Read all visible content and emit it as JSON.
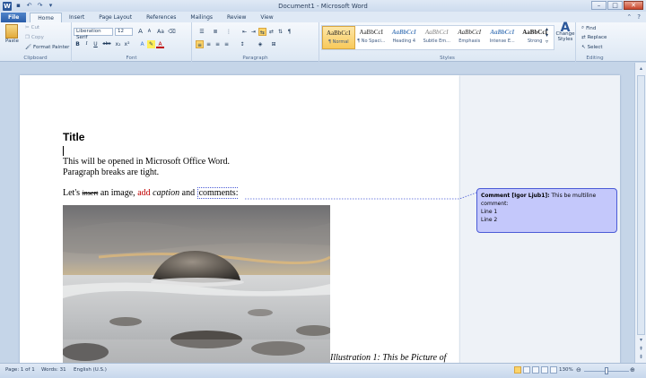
{
  "window": {
    "title": "Document1 - Microsoft Word",
    "app_icon": "W",
    "controls": {
      "minimize": "–",
      "maximize": "□",
      "close": "✕"
    }
  },
  "tabs": [
    "File",
    "Home",
    "Insert",
    "Page Layout",
    "References",
    "Mailings",
    "Review",
    "View"
  ],
  "ribbon": {
    "clipboard": {
      "paste": "Paste",
      "cut": "Cut",
      "copy": "Copy",
      "format_painter": "Format Painter",
      "label": "Clipboard"
    },
    "font": {
      "name": "Liberation Serif",
      "size": "12",
      "bold": "B",
      "italic": "I",
      "underline": "U",
      "strike": "abc",
      "subscript": "x₂",
      "superscript": "x²",
      "grow": "A",
      "shrink": "A",
      "case": "Aa",
      "label": "Font"
    },
    "paragraph": {
      "label": "Paragraph",
      "pilcrow": "¶"
    },
    "styles": {
      "items": [
        {
          "sample": "AaBbCcI",
          "name": "¶ Normal"
        },
        {
          "sample": "AaBbCcI",
          "name": "¶ No Spaci..."
        },
        {
          "sample": "AaBbCcI",
          "name": "Heading 4"
        },
        {
          "sample": "AaBbCcI",
          "name": "Subtle Em..."
        },
        {
          "sample": "AaBbCcI",
          "name": "Emphasis"
        },
        {
          "sample": "AaBbCcI",
          "name": "Intense E..."
        },
        {
          "sample": "AaBbCcI",
          "name": "Strong"
        }
      ],
      "change_styles": "Change Styles",
      "label": "Styles"
    },
    "editing": {
      "find": "Find",
      "replace": "Replace",
      "select": "Select",
      "label": "Editing"
    }
  },
  "document": {
    "title": "Title",
    "line1": "This will be opened in Microsoft Office Word.",
    "line2": "Paragraph breaks are tight.",
    "line3": {
      "p1": "Let's ",
      "deleted": "insert",
      "p2": " an image, ",
      "inserted": "add",
      "p3": " ",
      "italic": "caption",
      "p4": " and ",
      "commented": "comments:"
    },
    "caption": "Illustration 1: This be Picture of"
  },
  "comment": {
    "label": "Comment [Igor Ljub1]:",
    "text": "This be multiline comment:",
    "line1": "Line 1",
    "line2": "Line 2"
  },
  "status": {
    "page": "Page: 1 of 1",
    "words": "Words: 31",
    "language": "English (U.S.)",
    "zoom": "130%"
  },
  "colors": {
    "insertion": "#c00000",
    "comment_fill": "#c4c8fb",
    "comment_border": "#4a5bd6"
  }
}
